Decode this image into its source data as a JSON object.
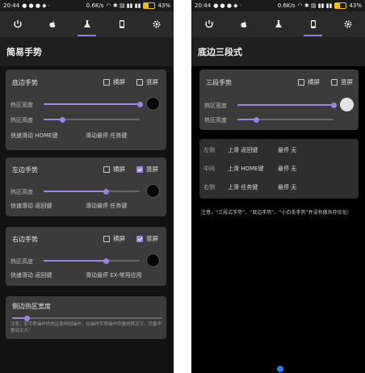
{
  "status": {
    "time": "20:44",
    "speed": "0.6K/s",
    "battery_pct": "43%",
    "battery_level": 0.43
  },
  "left": {
    "title": "简易手势",
    "cards": [
      {
        "title": "底边手势",
        "landscape": "横屏",
        "portrait": "竖屏",
        "landscape_checked": false,
        "portrait_checked": false,
        "width_label": "热区宽度",
        "height_label": "热区高度",
        "width_value": 1.0,
        "height_value": 0.2,
        "swipe_label": "快速滑动",
        "swipe_action": "HOME键",
        "hold_label": "滑动悬停",
        "hold_action": "任务键"
      },
      {
        "title": "左边手势",
        "landscape": "横屏",
        "portrait": "竖屏",
        "landscape_checked": false,
        "portrait_checked": true,
        "height_label": "热区高度",
        "height_value": 0.65,
        "swipe_label": "快速滑动",
        "swipe_action": "返回键",
        "hold_label": "滑动悬停",
        "hold_action": "任务键"
      },
      {
        "title": "右边手势",
        "landscape": "横屏",
        "portrait": "竖屏",
        "landscape_checked": false,
        "portrait_checked": true,
        "height_label": "热区高度",
        "height_value": 0.65,
        "swipe_label": "快速滑动",
        "swipe_action": "返回键",
        "hold_label": "滑动悬停",
        "hold_action": "EX-常用应用"
      }
    ],
    "side_width": {
      "title": "侧边热区宽度",
      "value": 0.1,
      "note": "注意，若手势操作的热区影响到操作，在操作手势操作尽量的情况下，尽量不要调太大！"
    }
  },
  "right": {
    "title": "底边三段式",
    "card": {
      "title": "三段手势",
      "landscape": "横屏",
      "portrait": "竖屏",
      "landscape_checked": false,
      "portrait_checked": false,
      "width_label": "热区宽度",
      "height_label": "热区高度",
      "width_value": 1.0,
      "height_value": 0.2
    },
    "mappings": [
      {
        "side": "左侧",
        "swipe_label": "上滑",
        "swipe_action": "返回键",
        "hold_label": "悬停",
        "hold_action": "无"
      },
      {
        "side": "中间",
        "swipe_label": "上滑",
        "swipe_action": "HOME键",
        "hold_label": "悬停",
        "hold_action": "无"
      },
      {
        "side": "右侧",
        "swipe_label": "上滑",
        "swipe_action": "任务键",
        "hold_label": "悬停",
        "hold_action": "无"
      }
    ],
    "note": "注意，“三段式手势”、“底边手势”、“小白条手势”并没有做共存优化!"
  },
  "colors": {
    "accent": "#9a85e0",
    "indicator": "#2e7df6"
  },
  "tabs": [
    "power-icon",
    "apple-icon",
    "flask-icon",
    "phone-icon",
    "gear-icon"
  ]
}
